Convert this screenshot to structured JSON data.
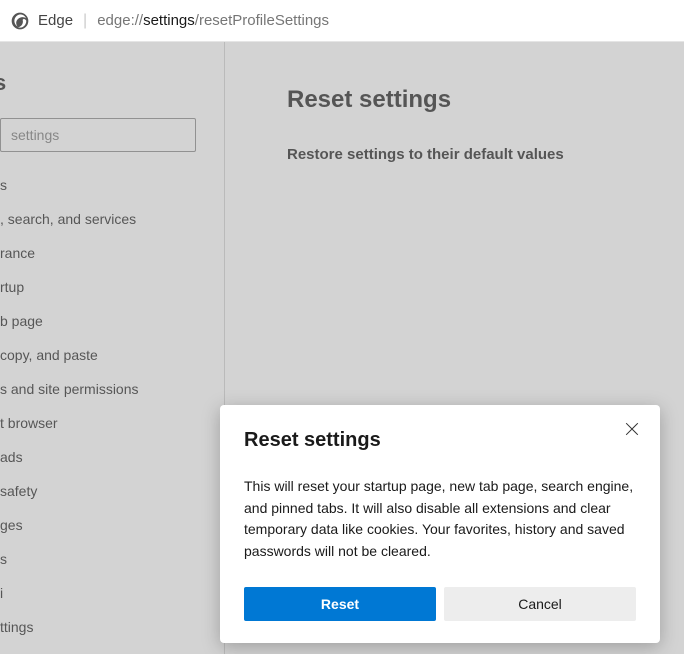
{
  "address_bar": {
    "app_label": "Edge",
    "url_prefix": "edge://",
    "url_strong": "settings",
    "url_suffix": "/resetProfileSettings"
  },
  "sidebar": {
    "title_fragment": "s",
    "search_placeholder": "settings",
    "items": [
      "s",
      ", search, and services",
      "rance",
      "rtup",
      "b page",
      "copy, and paste",
      "s and site permissions",
      "t browser",
      "ads",
      "safety",
      "ges",
      "s",
      "i",
      "ttings"
    ]
  },
  "main": {
    "heading": "Reset settings",
    "subtitle": "Restore settings to their default values"
  },
  "dialog": {
    "title": "Reset settings",
    "body": "This will reset your startup page, new tab page, search engine, and pinned tabs. It will also disable all extensions and clear temporary data like cookies. Your favorites, history and saved passwords will not be cleared.",
    "primary_label": "Reset",
    "secondary_label": "Cancel"
  }
}
